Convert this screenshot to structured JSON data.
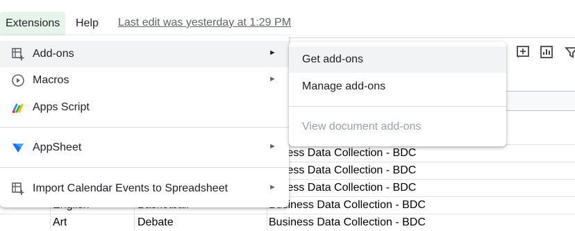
{
  "menubar": {
    "items": [
      {
        "label": "Extensions"
      },
      {
        "label": "Help"
      }
    ],
    "last_edit": "Last edit was yesterday at 1:29 PM"
  },
  "toolbar": {
    "icons": [
      "insert-comment-icon",
      "insert-chart-icon",
      "filter-icon"
    ]
  },
  "extensions_menu": {
    "items": [
      {
        "label": "Add-ons",
        "icon": "add-ons-icon",
        "has_submenu": true
      },
      {
        "label": "Macros",
        "icon": "macros-play-icon",
        "has_submenu": true
      },
      {
        "label": "Apps Script",
        "icon": "apps-script-icon",
        "has_submenu": false
      },
      {
        "label": "AppSheet",
        "icon": "appsheet-icon",
        "has_submenu": true
      },
      {
        "label": "Import Calendar Events to Spreadsheet",
        "icon": "add-ons-icon",
        "has_submenu": true
      }
    ],
    "submenu_arrow": "►"
  },
  "addons_submenu": {
    "items": [
      {
        "label": "Get add-ons",
        "enabled": true
      },
      {
        "label": "Manage add-ons",
        "enabled": true
      },
      {
        "label": "View document add-ons",
        "enabled": false
      }
    ]
  },
  "sheet": {
    "rows": [
      {
        "a": "",
        "b": "",
        "c": "siness Data Collection - BDC"
      },
      {
        "a": "",
        "b": "",
        "c": "siness Data Collection - BDC"
      },
      {
        "a": "",
        "b": "",
        "c": "siness Data Collection - BDC"
      },
      {
        "a": "English",
        "b": "Basketball",
        "c": "Business Data Collection - BDC"
      },
      {
        "a": "Art",
        "b": "Debate",
        "c": "Business Data Collection - BDC"
      }
    ]
  },
  "colors": {
    "menu_hover": "#f1f3f4",
    "active_menu": "#e6f4ea",
    "appsheet_blue": "#1a73e8"
  }
}
